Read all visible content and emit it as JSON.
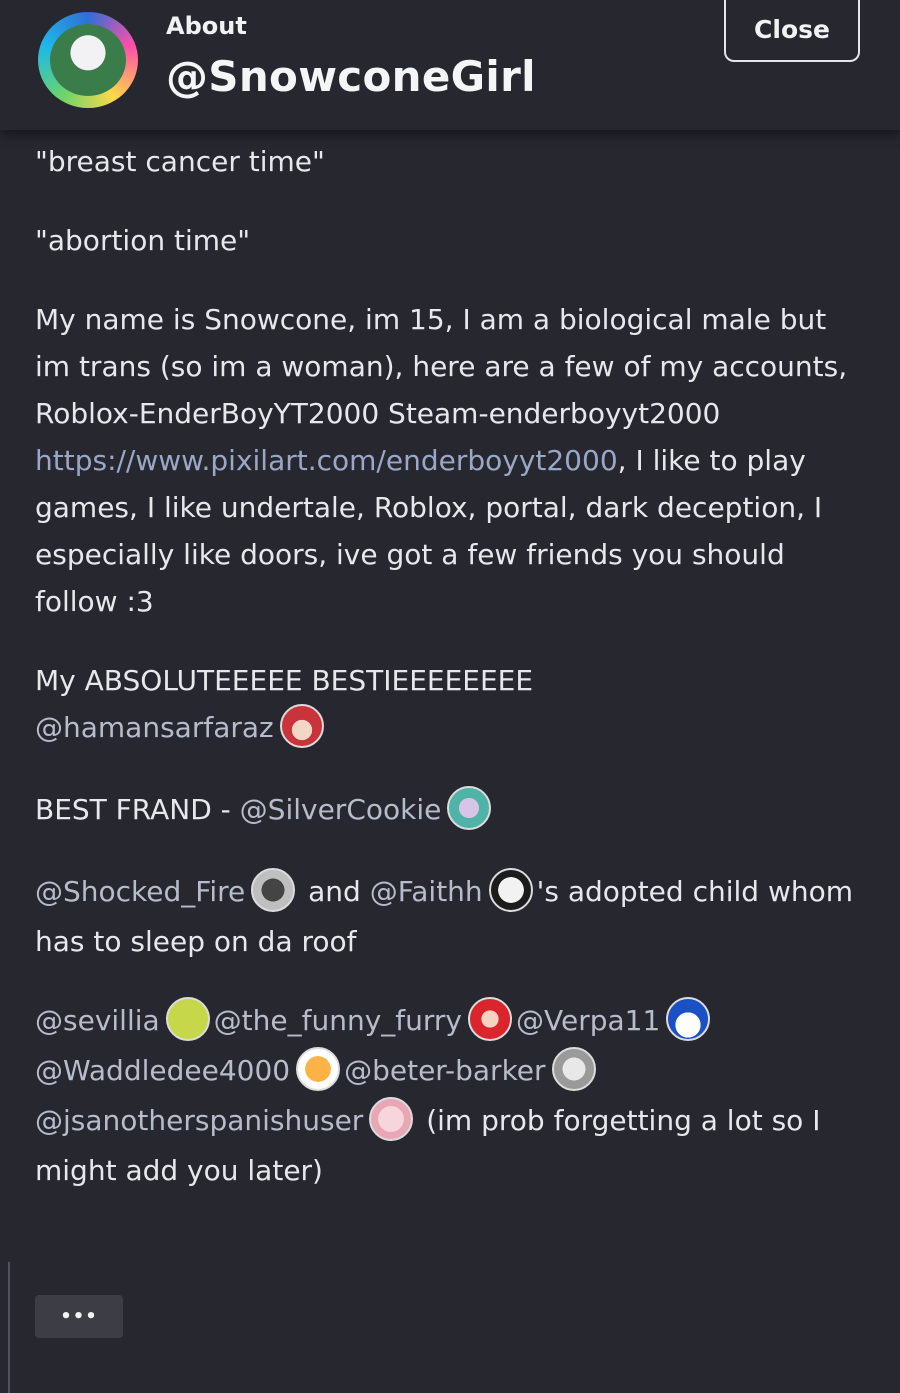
{
  "header": {
    "about_label": "About",
    "username": "@SnowconeGirl",
    "close_label": "Close",
    "avatar_icon": "profile-avatar-icon"
  },
  "bio": {
    "line1": "\"breast cancer time\"",
    "line2": "\"abortion time\"",
    "intro_text": "My name is Snowcone, im 15, I am a biological male but im trans (so im a woman), here are a few of my accounts, Roblox-EnderBoyYT2000 Steam-enderboyyt2000",
    "pixilart_link": "https://www.pixilart.com/enderboyyt2000",
    "intro_tail": ", I like to play games, I like undertale, Roblox, portal, dark deception, I especially like doors, ive got a few friends you should follow :3",
    "bestie_label": "My ABSOLUTEEEEE BESTIEEEEEEEE",
    "bestie_mention": "@hamansarfaraz",
    "best_frand_label": "BEST FRAND - ",
    "best_frand_mention": "@SilverCookie",
    "shocked_mention": "@Shocked_Fire",
    "and_text": " and ",
    "faithh_mention": "@Faithh",
    "adopted_text": "'s adopted child whom has to sleep on da roof",
    "friends": [
      "@sevillia",
      "@the_funny_furry",
      "@Verpa11",
      "@Waddledee4000",
      "@beter-barker",
      "@jsanotherspanishuser"
    ],
    "closing_text": " (im prob forgetting a lot so I might add you later)"
  },
  "more_button_label": "•••",
  "colors": {
    "background": "#26272f",
    "link": "#9aa7c6",
    "button": "#3c3d45"
  }
}
